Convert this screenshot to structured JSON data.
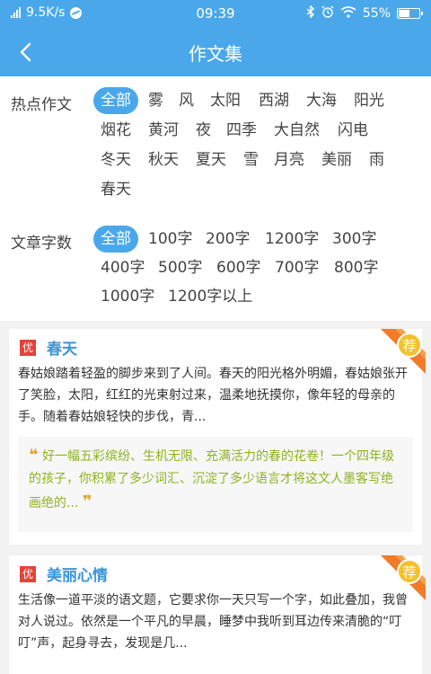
{
  "status_bar": {
    "speed": "9.5K/s",
    "time": "09:39",
    "battery_percent": "55%",
    "battery_level": 0.55
  },
  "header": {
    "title": "作文集",
    "back_icon": "chevron-left-icon"
  },
  "filters": {
    "hot_label": "热点作文",
    "hot_options": [
      "全部",
      "雾",
      "风",
      "太阳",
      "西湖",
      "大海",
      "阳光",
      "烟花",
      "黄河",
      "夜",
      "四季",
      "大自然",
      "闪电",
      "冬天",
      "秋天",
      "夏天",
      "雪",
      "月亮",
      "美丽",
      "雨",
      "春天"
    ],
    "hot_selected": "全部",
    "count_label": "文章字数",
    "count_options": [
      "全部",
      "100字",
      "200字",
      "1200字",
      "300字",
      "400字",
      "500字",
      "600字",
      "700字",
      "800字",
      "1000字",
      "1200字以上"
    ],
    "count_selected": "全部"
  },
  "articles": [
    {
      "tag": "优",
      "title": "春天",
      "badge": "荐",
      "excerpt": "春姑娘踏着轻盈的脚步来到了人间。春天的阳光格外明媚，春姑娘张开了笑脸，太阳，红红的光束射过来，温柔地抚摸你，像年轻的母亲的手。随着春姑娘轻快的步伐，青...",
      "comment": "好一幅五彩缤纷、生机无限、充满活力的春的花卷！一个四年级的孩子，你积累了多少词汇、沉淀了多少语言才将这文人墨客写绝画绝的..."
    },
    {
      "tag": "优",
      "title": "美丽心情",
      "badge": "荐",
      "excerpt": "生活像一道平淡的语文题，它要求你一天只写一个字，如此叠加，我曾对人说过。依然是一个平凡的早晨，睡梦中我听到耳边传来清脆的“叮叮”声，起身寻去，发现是几..."
    }
  ],
  "colors": {
    "primary": "#4aa8ea",
    "tag_red": "#e4433a",
    "comment_green": "#8fb21f",
    "quote_mark": "#e2a52e",
    "ribbon_orange": "#f07b2a"
  }
}
